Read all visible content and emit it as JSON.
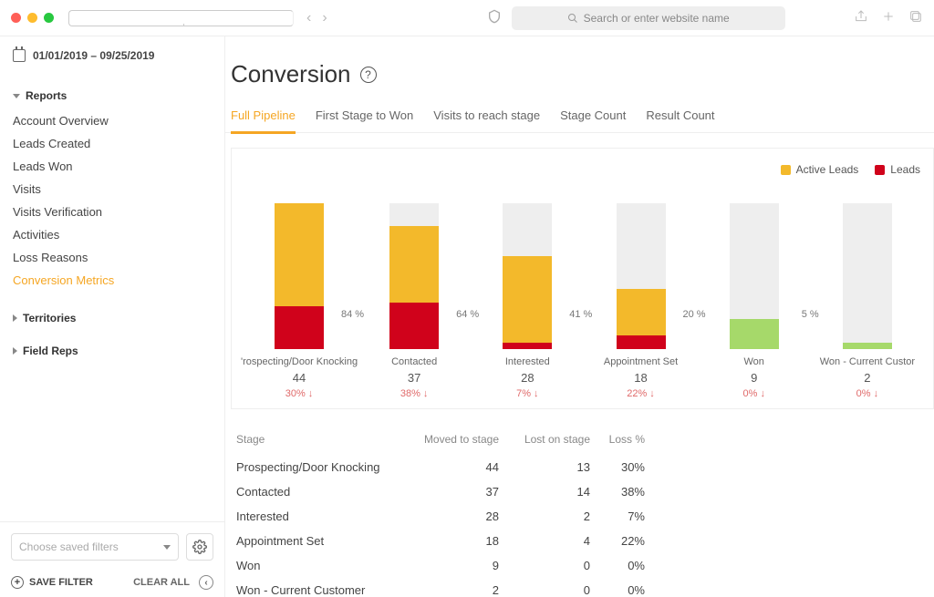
{
  "chrome": {
    "search_placeholder": "Search or enter website name"
  },
  "date_range": "01/01/2019 – 09/25/2019",
  "sidebar": {
    "sections": [
      {
        "title": "Reports",
        "open": true,
        "items": [
          {
            "label": "Account Overview"
          },
          {
            "label": "Leads Created"
          },
          {
            "label": "Leads Won"
          },
          {
            "label": "Visits"
          },
          {
            "label": "Visits Verification"
          },
          {
            "label": "Activities"
          },
          {
            "label": "Loss Reasons"
          },
          {
            "label": "Conversion Metrics",
            "active": true
          }
        ]
      },
      {
        "title": "Territories",
        "open": false
      },
      {
        "title": "Field Reps",
        "open": false
      }
    ],
    "filter_placeholder": "Choose saved filters",
    "save_filter": "SAVE FILTER",
    "clear_all": "CLEAR ALL"
  },
  "page": {
    "title": "Conversion",
    "tabs": [
      {
        "label": "Full Pipeline",
        "active": true
      },
      {
        "label": "First Stage to Won"
      },
      {
        "label": "Visits to reach stage"
      },
      {
        "label": "Stage Count"
      },
      {
        "label": "Result Count"
      }
    ]
  },
  "legend": {
    "active": "Active Leads",
    "lost": "Leads"
  },
  "chart_data": {
    "type": "bar",
    "series_meta": [
      {
        "name": "Active Leads",
        "color": "#f3b92b"
      },
      {
        "name": "Leads Lost",
        "color": "#d0021b"
      },
      {
        "name": "Won",
        "color": "#a6d96a"
      }
    ],
    "total_leads": 44,
    "columns": [
      {
        "stage": "Prospecting/Door Knocking",
        "moved": 44,
        "lost": 13,
        "loss_pct": "30%",
        "conv_pct_right": "84 %",
        "active": 31,
        "won": 0,
        "stage_label": "'rospecting/Door Knocking"
      },
      {
        "stage": "Contacted",
        "moved": 37,
        "lost": 14,
        "loss_pct": "38%",
        "conv_pct_right": "64 %",
        "active": 23,
        "won": 0,
        "stage_label": "Contacted"
      },
      {
        "stage": "Interested",
        "moved": 28,
        "lost": 2,
        "loss_pct": "7%",
        "conv_pct_right": "41 %",
        "active": 26,
        "won": 0,
        "stage_label": "Interested"
      },
      {
        "stage": "Appointment Set",
        "moved": 18,
        "lost": 4,
        "loss_pct": "22%",
        "conv_pct_right": "20 %",
        "active": 14,
        "won": 0,
        "stage_label": "Appointment Set"
      },
      {
        "stage": "Won",
        "moved": 9,
        "lost": 0,
        "loss_pct": "0%",
        "conv_pct_right": "5 %",
        "active": 0,
        "won": 9,
        "stage_label": "Won"
      },
      {
        "stage": "Won - Current Customer",
        "moved": 2,
        "lost": 0,
        "loss_pct": "0%",
        "conv_pct_right": "",
        "active": 0,
        "won": 2,
        "stage_label": "Won - Current Custor"
      }
    ]
  },
  "table": {
    "headers": {
      "stage": "Stage",
      "moved": "Moved to stage",
      "lost": "Lost on stage",
      "loss_pct": "Loss %"
    },
    "rows": [
      {
        "stage": "Prospecting/Door Knocking",
        "moved": "44",
        "lost": "13",
        "loss_pct": "30%"
      },
      {
        "stage": "Contacted",
        "moved": "37",
        "lost": "14",
        "loss_pct": "38%"
      },
      {
        "stage": "Interested",
        "moved": "28",
        "lost": "2",
        "loss_pct": "7%"
      },
      {
        "stage": "Appointment Set",
        "moved": "18",
        "lost": "4",
        "loss_pct": "22%"
      },
      {
        "stage": "Won",
        "moved": "9",
        "lost": "0",
        "loss_pct": "0%"
      },
      {
        "stage": "Won - Current Customer",
        "moved": "2",
        "lost": "0",
        "loss_pct": "0%"
      }
    ]
  }
}
